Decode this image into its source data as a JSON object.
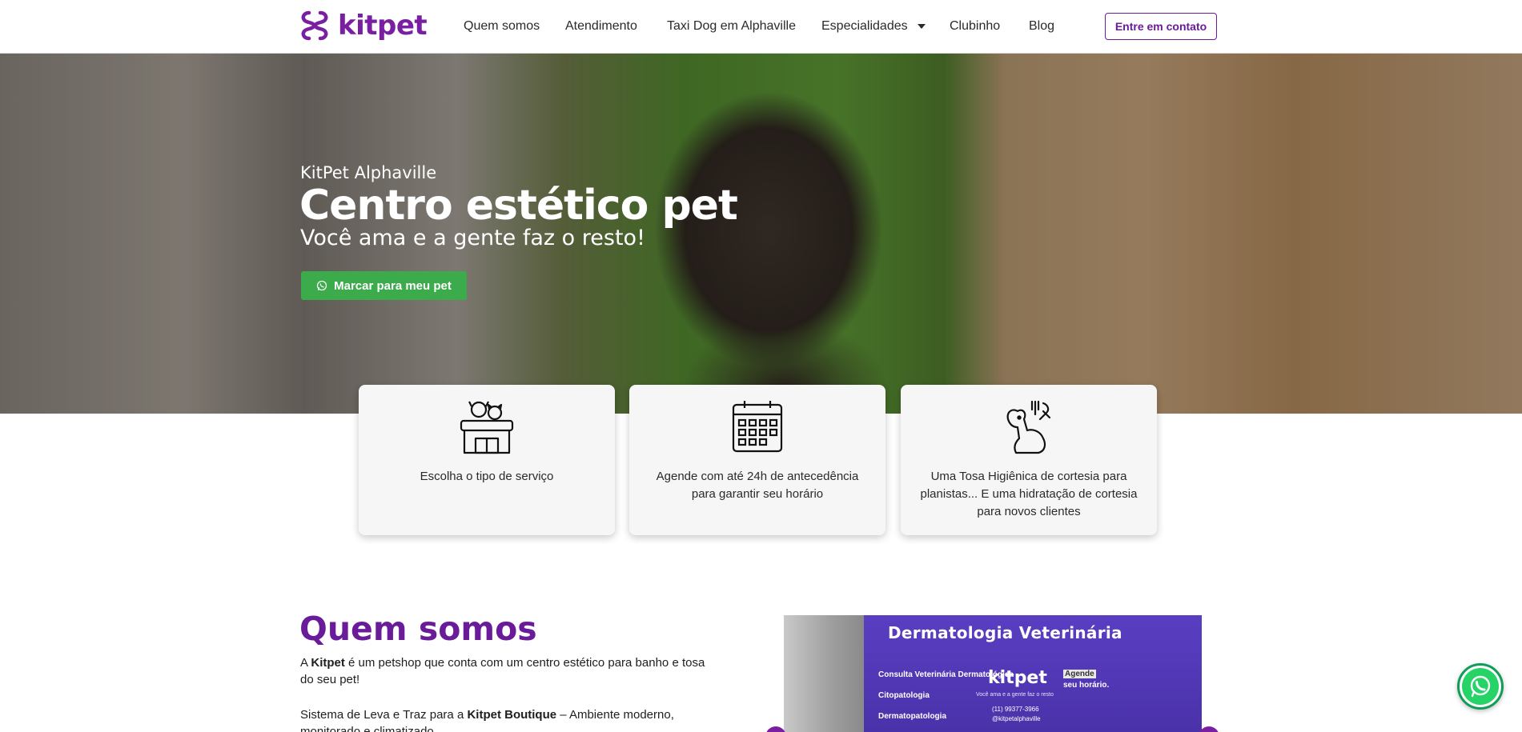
{
  "brand": {
    "name": "kitpet",
    "color": "#7b1fa2"
  },
  "nav": {
    "items": [
      {
        "label": "Quem somos"
      },
      {
        "label": "Atendimento"
      },
      {
        "label": "Taxi Dog em Alphaville"
      },
      {
        "label": "Especialidades",
        "has_dropdown": true
      },
      {
        "label": "Clubinho"
      },
      {
        "label": "Blog"
      }
    ],
    "cta_label": "Entre em contato"
  },
  "hero": {
    "location": "KitPet Alphaville",
    "title": "Centro estético pet",
    "tagline": "Você ama e a gente faz o resto!",
    "button_label": "Marcar para meu pet",
    "button_icon": "whatsapp-icon",
    "button_color": "#3cab4b"
  },
  "features": [
    {
      "icon": "storefront-pets-icon",
      "text": "Escolha o tipo de serviço"
    },
    {
      "icon": "calendar-icon",
      "text": "Agende com até 24h de antecedência para garantir seu horário"
    },
    {
      "icon": "dog-grooming-icon",
      "text": "Uma Tosa Higiênica de cortesia para planistas... E uma hidratação de cortesia para novos clientes"
    }
  ],
  "about": {
    "title": "Quem somos",
    "p1_prefix": "A ",
    "p1_bold": "Kitpet",
    "p1_suffix": " é um petshop que conta com um centro estético para banho e tosa do seu pet!",
    "p2_prefix": "Sistema de Leva e Traz para a ",
    "p2_bold": "Kitpet Boutique",
    "p2_suffix": " – Ambiente moderno, monitorado e climatizado."
  },
  "photo": {
    "banner": "Dermatologia Veterinária",
    "services": [
      "Consulta Veterinária Dermatológica",
      "Citopatologia",
      "Dermatopatologia"
    ],
    "logo_text": "kitpet",
    "logo_sub": "Você ama e a gente faz o resto",
    "agende_label": "Agende",
    "agende_sub": "seu horário.",
    "phone": "(11) 99377-3966",
    "handle": "@kitpetalphaville"
  },
  "floating": {
    "icon": "whatsapp-icon"
  }
}
